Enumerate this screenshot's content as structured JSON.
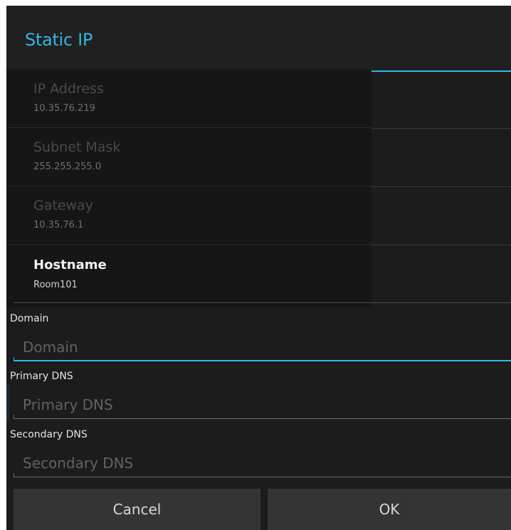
{
  "dialog": {
    "title": "Static IP"
  },
  "preferences": [
    {
      "title": "IP Address",
      "summary": "10.35.76.219",
      "enabled": false
    },
    {
      "title": "Subnet Mask",
      "summary": "255.255.255.0",
      "enabled": false
    },
    {
      "title": "Gateway",
      "summary": "10.35.76.1",
      "enabled": false
    },
    {
      "title": "Hostname",
      "summary": "Room101",
      "enabled": true
    }
  ],
  "fields": {
    "domain": {
      "label": "Domain",
      "placeholder": "Domain",
      "value": ""
    },
    "primary_dns": {
      "label": "Primary DNS",
      "placeholder": "Primary DNS",
      "value": ""
    },
    "secondary_dns": {
      "label": "Secondary DNS",
      "placeholder": "Secondary DNS",
      "value": ""
    }
  },
  "buttons": {
    "cancel": "Cancel",
    "ok": "OK"
  },
  "colors": {
    "accent": "#33b5e5",
    "background": "#1c1c1c",
    "button": "#343434"
  }
}
